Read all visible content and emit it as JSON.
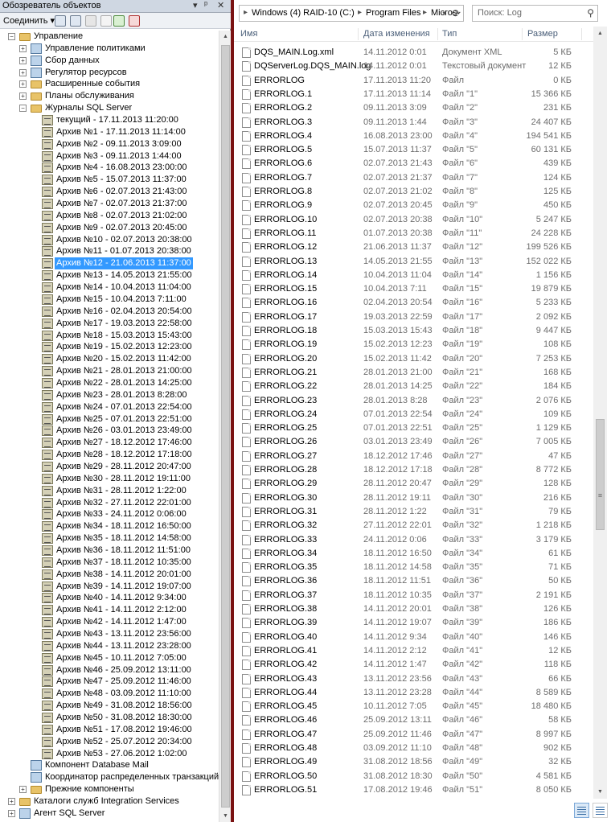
{
  "object_explorer": {
    "title": "Обозреватель объектов",
    "title_controls": [
      "▾",
      "ᵖ",
      "✕"
    ],
    "connect_label": "Соединить ▾",
    "tree": [
      {
        "label": "Управление",
        "level": 1,
        "expander": "−",
        "icon": "folder"
      },
      {
        "label": "Управление политиками",
        "level": 2,
        "expander": "+",
        "icon": "policy"
      },
      {
        "label": "Сбор данных",
        "level": 2,
        "expander": "+",
        "icon": "generic"
      },
      {
        "label": "Регулятор ресурсов",
        "level": 2,
        "expander": "+",
        "icon": "generic"
      },
      {
        "label": "Расширенные события",
        "level": 2,
        "expander": "+",
        "icon": "folder"
      },
      {
        "label": "Планы обслуживания",
        "level": 2,
        "expander": "+",
        "icon": "folder"
      },
      {
        "label": "Журналы SQL Server",
        "level": 2,
        "expander": "−",
        "icon": "folder"
      },
      {
        "label": "текущий - 17.11.2013 11:20:00",
        "level": 3,
        "icon": "log"
      },
      {
        "label": "Архив №1 - 17.11.2013 11:14:00",
        "level": 3,
        "icon": "log"
      },
      {
        "label": "Архив №2 - 09.11.2013 3:09:00",
        "level": 3,
        "icon": "log"
      },
      {
        "label": "Архив №3 - 09.11.2013 1:44:00",
        "level": 3,
        "icon": "log"
      },
      {
        "label": "Архив №4 - 16.08.2013 23:00:00",
        "level": 3,
        "icon": "log"
      },
      {
        "label": "Архив №5 - 15.07.2013 11:37:00",
        "level": 3,
        "icon": "log"
      },
      {
        "label": "Архив №6 - 02.07.2013 21:43:00",
        "level": 3,
        "icon": "log"
      },
      {
        "label": "Архив №7 - 02.07.2013 21:37:00",
        "level": 3,
        "icon": "log"
      },
      {
        "label": "Архив №8 - 02.07.2013 21:02:00",
        "level": 3,
        "icon": "log"
      },
      {
        "label": "Архив №9 - 02.07.2013 20:45:00",
        "level": 3,
        "icon": "log"
      },
      {
        "label": "Архив №10 - 02.07.2013 20:38:00",
        "level": 3,
        "icon": "log"
      },
      {
        "label": "Архив №11 - 01.07.2013 20:38:00",
        "level": 3,
        "icon": "log"
      },
      {
        "label": "Архив №12 - 21.06.2013 11:37:00",
        "level": 3,
        "icon": "log",
        "selected": true
      },
      {
        "label": "Архив №13 - 14.05.2013 21:55:00",
        "level": 3,
        "icon": "log"
      },
      {
        "label": "Архив №14 - 10.04.2013 11:04:00",
        "level": 3,
        "icon": "log"
      },
      {
        "label": "Архив №15 - 10.04.2013 7:11:00",
        "level": 3,
        "icon": "log"
      },
      {
        "label": "Архив №16 - 02.04.2013 20:54:00",
        "level": 3,
        "icon": "log"
      },
      {
        "label": "Архив №17 - 19.03.2013 22:58:00",
        "level": 3,
        "icon": "log"
      },
      {
        "label": "Архив №18 - 15.03.2013 15:43:00",
        "level": 3,
        "icon": "log"
      },
      {
        "label": "Архив №19 - 15.02.2013 12:23:00",
        "level": 3,
        "icon": "log"
      },
      {
        "label": "Архив №20 - 15.02.2013 11:42:00",
        "level": 3,
        "icon": "log"
      },
      {
        "label": "Архив №21 - 28.01.2013 21:00:00",
        "level": 3,
        "icon": "log"
      },
      {
        "label": "Архив №22 - 28.01.2013 14:25:00",
        "level": 3,
        "icon": "log"
      },
      {
        "label": "Архив №23 - 28.01.2013 8:28:00",
        "level": 3,
        "icon": "log"
      },
      {
        "label": "Архив №24 - 07.01.2013 22:54:00",
        "level": 3,
        "icon": "log"
      },
      {
        "label": "Архив №25 - 07.01.2013 22:51:00",
        "level": 3,
        "icon": "log"
      },
      {
        "label": "Архив №26 - 03.01.2013 23:49:00",
        "level": 3,
        "icon": "log"
      },
      {
        "label": "Архив №27 - 18.12.2012 17:46:00",
        "level": 3,
        "icon": "log"
      },
      {
        "label": "Архив №28 - 18.12.2012 17:18:00",
        "level": 3,
        "icon": "log"
      },
      {
        "label": "Архив №29 - 28.11.2012 20:47:00",
        "level": 3,
        "icon": "log"
      },
      {
        "label": "Архив №30 - 28.11.2012 19:11:00",
        "level": 3,
        "icon": "log"
      },
      {
        "label": "Архив №31 - 28.11.2012 1:22:00",
        "level": 3,
        "icon": "log"
      },
      {
        "label": "Архив №32 - 27.11.2012 22:01:00",
        "level": 3,
        "icon": "log"
      },
      {
        "label": "Архив №33 - 24.11.2012 0:06:00",
        "level": 3,
        "icon": "log"
      },
      {
        "label": "Архив №34 - 18.11.2012 16:50:00",
        "level": 3,
        "icon": "log"
      },
      {
        "label": "Архив №35 - 18.11.2012 14:58:00",
        "level": 3,
        "icon": "log"
      },
      {
        "label": "Архив №36 - 18.11.2012 11:51:00",
        "level": 3,
        "icon": "log"
      },
      {
        "label": "Архив №37 - 18.11.2012 10:35:00",
        "level": 3,
        "icon": "log"
      },
      {
        "label": "Архив №38 - 14.11.2012 20:01:00",
        "level": 3,
        "icon": "log"
      },
      {
        "label": "Архив №39 - 14.11.2012 19:07:00",
        "level": 3,
        "icon": "log"
      },
      {
        "label": "Архив №40 - 14.11.2012 9:34:00",
        "level": 3,
        "icon": "log"
      },
      {
        "label": "Архив №41 - 14.11.2012 2:12:00",
        "level": 3,
        "icon": "log"
      },
      {
        "label": "Архив №42 - 14.11.2012 1:47:00",
        "level": 3,
        "icon": "log"
      },
      {
        "label": "Архив №43 - 13.11.2012 23:56:00",
        "level": 3,
        "icon": "log"
      },
      {
        "label": "Архив №44 - 13.11.2012 23:28:00",
        "level": 3,
        "icon": "log"
      },
      {
        "label": "Архив №45 - 10.11.2012 7:05:00",
        "level": 3,
        "icon": "log"
      },
      {
        "label": "Архив №46 - 25.09.2012 13:11:00",
        "level": 3,
        "icon": "log"
      },
      {
        "label": "Архив №47 - 25.09.2012 11:46:00",
        "level": 3,
        "icon": "log"
      },
      {
        "label": "Архив №48 - 03.09.2012 11:10:00",
        "level": 3,
        "icon": "log"
      },
      {
        "label": "Архив №49 - 31.08.2012 18:56:00",
        "level": 3,
        "icon": "log"
      },
      {
        "label": "Архив №50 - 31.08.2012 18:30:00",
        "level": 3,
        "icon": "log"
      },
      {
        "label": "Архив №51 - 17.08.2012 19:46:00",
        "level": 3,
        "icon": "log"
      },
      {
        "label": "Архив №52 - 25.07.2012 20:34:00",
        "level": 3,
        "icon": "log"
      },
      {
        "label": "Архив №53 - 27.06.2012 1:02:00",
        "level": 3,
        "icon": "log"
      },
      {
        "label": "Компонент Database Mail",
        "level": 2,
        "icon": "generic"
      },
      {
        "label": "Координатор распределенных транзакций",
        "level": 2,
        "icon": "generic"
      },
      {
        "label": "Прежние компоненты",
        "level": 2,
        "expander": "+",
        "icon": "folder"
      },
      {
        "label": "Каталоги служб Integration Services",
        "level": 1,
        "expander": "+",
        "icon": "folder"
      },
      {
        "label": "Агент SQL Server",
        "level": 1,
        "expander": "+",
        "icon": "generic"
      }
    ]
  },
  "explorer": {
    "breadcrumb": [
      "Windows (4) RAID-10 (C:)",
      "Program Files",
      "Micros"
    ],
    "search_placeholder": "Поиск: Log",
    "columns": {
      "name": "Имя",
      "date": "Дата изменения",
      "type": "Тип",
      "size": "Размер"
    },
    "files": [
      {
        "name": "DQS_MAIN.Log.xml",
        "date": "14.11.2012 0:01",
        "type": "Документ XML",
        "size": "5 КБ"
      },
      {
        "name": "DQServerLog.DQS_MAIN.log",
        "date": "14.11.2012 0:01",
        "type": "Текстовый документ",
        "size": "12 КБ"
      },
      {
        "name": "ERRORLOG",
        "date": "17.11.2013 11:20",
        "type": "Файл",
        "size": "0 КБ"
      },
      {
        "name": "ERRORLOG.1",
        "date": "17.11.2013 11:14",
        "type": "Файл \"1\"",
        "size": "15 366 КБ"
      },
      {
        "name": "ERRORLOG.2",
        "date": "09.11.2013 3:09",
        "type": "Файл \"2\"",
        "size": "231 КБ"
      },
      {
        "name": "ERRORLOG.3",
        "date": "09.11.2013 1:44",
        "type": "Файл \"3\"",
        "size": "24 407 КБ"
      },
      {
        "name": "ERRORLOG.4",
        "date": "16.08.2013 23:00",
        "type": "Файл \"4\"",
        "size": "194 541 КБ"
      },
      {
        "name": "ERRORLOG.5",
        "date": "15.07.2013 11:37",
        "type": "Файл \"5\"",
        "size": "60 131 КБ"
      },
      {
        "name": "ERRORLOG.6",
        "date": "02.07.2013 21:43",
        "type": "Файл \"6\"",
        "size": "439 КБ"
      },
      {
        "name": "ERRORLOG.7",
        "date": "02.07.2013 21:37",
        "type": "Файл \"7\"",
        "size": "124 КБ"
      },
      {
        "name": "ERRORLOG.8",
        "date": "02.07.2013 21:02",
        "type": "Файл \"8\"",
        "size": "125 КБ"
      },
      {
        "name": "ERRORLOG.9",
        "date": "02.07.2013 20:45",
        "type": "Файл \"9\"",
        "size": "450 КБ"
      },
      {
        "name": "ERRORLOG.10",
        "date": "02.07.2013 20:38",
        "type": "Файл \"10\"",
        "size": "5 247 КБ"
      },
      {
        "name": "ERRORLOG.11",
        "date": "01.07.2013 20:38",
        "type": "Файл \"11\"",
        "size": "24 228 КБ"
      },
      {
        "name": "ERRORLOG.12",
        "date": "21.06.2013 11:37",
        "type": "Файл \"12\"",
        "size": "199 526 КБ"
      },
      {
        "name": "ERRORLOG.13",
        "date": "14.05.2013 21:55",
        "type": "Файл \"13\"",
        "size": "152 022 КБ"
      },
      {
        "name": "ERRORLOG.14",
        "date": "10.04.2013 11:04",
        "type": "Файл \"14\"",
        "size": "1 156 КБ"
      },
      {
        "name": "ERRORLOG.15",
        "date": "10.04.2013 7:11",
        "type": "Файл \"15\"",
        "size": "19 879 КБ"
      },
      {
        "name": "ERRORLOG.16",
        "date": "02.04.2013 20:54",
        "type": "Файл \"16\"",
        "size": "5 233 КБ"
      },
      {
        "name": "ERRORLOG.17",
        "date": "19.03.2013 22:59",
        "type": "Файл \"17\"",
        "size": "2 092 КБ"
      },
      {
        "name": "ERRORLOG.18",
        "date": "15.03.2013 15:43",
        "type": "Файл \"18\"",
        "size": "9 447 КБ"
      },
      {
        "name": "ERRORLOG.19",
        "date": "15.02.2013 12:23",
        "type": "Файл \"19\"",
        "size": "108 КБ"
      },
      {
        "name": "ERRORLOG.20",
        "date": "15.02.2013 11:42",
        "type": "Файл \"20\"",
        "size": "7 253 КБ"
      },
      {
        "name": "ERRORLOG.21",
        "date": "28.01.2013 21:00",
        "type": "Файл \"21\"",
        "size": "168 КБ"
      },
      {
        "name": "ERRORLOG.22",
        "date": "28.01.2013 14:25",
        "type": "Файл \"22\"",
        "size": "184 КБ"
      },
      {
        "name": "ERRORLOG.23",
        "date": "28.01.2013 8:28",
        "type": "Файл \"23\"",
        "size": "2 076 КБ"
      },
      {
        "name": "ERRORLOG.24",
        "date": "07.01.2013 22:54",
        "type": "Файл \"24\"",
        "size": "109 КБ"
      },
      {
        "name": "ERRORLOG.25",
        "date": "07.01.2013 22:51",
        "type": "Файл \"25\"",
        "size": "1 129 КБ"
      },
      {
        "name": "ERRORLOG.26",
        "date": "03.01.2013 23:49",
        "type": "Файл \"26\"",
        "size": "7 005 КБ"
      },
      {
        "name": "ERRORLOG.27",
        "date": "18.12.2012 17:46",
        "type": "Файл \"27\"",
        "size": "47 КБ"
      },
      {
        "name": "ERRORLOG.28",
        "date": "18.12.2012 17:18",
        "type": "Файл \"28\"",
        "size": "8 772 КБ"
      },
      {
        "name": "ERRORLOG.29",
        "date": "28.11.2012 20:47",
        "type": "Файл \"29\"",
        "size": "128 КБ"
      },
      {
        "name": "ERRORLOG.30",
        "date": "28.11.2012 19:11",
        "type": "Файл \"30\"",
        "size": "216 КБ"
      },
      {
        "name": "ERRORLOG.31",
        "date": "28.11.2012 1:22",
        "type": "Файл \"31\"",
        "size": "79 КБ"
      },
      {
        "name": "ERRORLOG.32",
        "date": "27.11.2012 22:01",
        "type": "Файл \"32\"",
        "size": "1 218 КБ"
      },
      {
        "name": "ERRORLOG.33",
        "date": "24.11.2012 0:06",
        "type": "Файл \"33\"",
        "size": "3 179 КБ"
      },
      {
        "name": "ERRORLOG.34",
        "date": "18.11.2012 16:50",
        "type": "Файл \"34\"",
        "size": "61 КБ"
      },
      {
        "name": "ERRORLOG.35",
        "date": "18.11.2012 14:58",
        "type": "Файл \"35\"",
        "size": "71 КБ"
      },
      {
        "name": "ERRORLOG.36",
        "date": "18.11.2012 11:51",
        "type": "Файл \"36\"",
        "size": "50 КБ"
      },
      {
        "name": "ERRORLOG.37",
        "date": "18.11.2012 10:35",
        "type": "Файл \"37\"",
        "size": "2 191 КБ"
      },
      {
        "name": "ERRORLOG.38",
        "date": "14.11.2012 20:01",
        "type": "Файл \"38\"",
        "size": "126 КБ"
      },
      {
        "name": "ERRORLOG.39",
        "date": "14.11.2012 19:07",
        "type": "Файл \"39\"",
        "size": "186 КБ"
      },
      {
        "name": "ERRORLOG.40",
        "date": "14.11.2012 9:34",
        "type": "Файл \"40\"",
        "size": "146 КБ"
      },
      {
        "name": "ERRORLOG.41",
        "date": "14.11.2012 2:12",
        "type": "Файл \"41\"",
        "size": "12 КБ"
      },
      {
        "name": "ERRORLOG.42",
        "date": "14.11.2012 1:47",
        "type": "Файл \"42\"",
        "size": "118 КБ"
      },
      {
        "name": "ERRORLOG.43",
        "date": "13.11.2012 23:56",
        "type": "Файл \"43\"",
        "size": "66 КБ"
      },
      {
        "name": "ERRORLOG.44",
        "date": "13.11.2012 23:28",
        "type": "Файл \"44\"",
        "size": "8 589 КБ"
      },
      {
        "name": "ERRORLOG.45",
        "date": "10.11.2012 7:05",
        "type": "Файл \"45\"",
        "size": "18 480 КБ"
      },
      {
        "name": "ERRORLOG.46",
        "date": "25.09.2012 13:11",
        "type": "Файл \"46\"",
        "size": "58 КБ"
      },
      {
        "name": "ERRORLOG.47",
        "date": "25.09.2012 11:46",
        "type": "Файл \"47\"",
        "size": "8 997 КБ"
      },
      {
        "name": "ERRORLOG.48",
        "date": "03.09.2012 11:10",
        "type": "Файл \"48\"",
        "size": "902 КБ"
      },
      {
        "name": "ERRORLOG.49",
        "date": "31.08.2012 18:56",
        "type": "Файл \"49\"",
        "size": "32 КБ"
      },
      {
        "name": "ERRORLOG.50",
        "date": "31.08.2012 18:30",
        "type": "Файл \"50\"",
        "size": "4 581 КБ"
      },
      {
        "name": "ERRORLOG.51",
        "date": "17.08.2012 19:46",
        "type": "Файл \"51\"",
        "size": "8 050 КБ"
      }
    ]
  },
  "colors": {
    "selection": "#3399ff",
    "divider": "#7a1212",
    "header_text": "#4c607a",
    "muted_text": "#6d6d6d"
  }
}
